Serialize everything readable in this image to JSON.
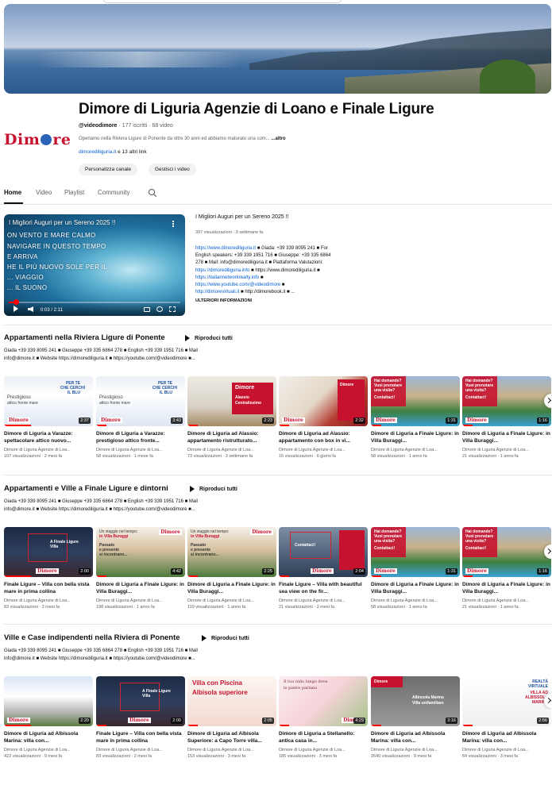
{
  "channel": {
    "title": "Dimore di Liguria Agenzie di Loano e Finale Ligure",
    "logo_text_a": "Dim",
    "logo_text_b": "re",
    "handle": "@videodimore",
    "subscribers": "177 iscritti",
    "videos": "68 video",
    "description": "Operiamo nella Riviera Ligure di Ponente da oltre 30 anni ed abbiamo maturato una com...",
    "more": "...altro",
    "link": "dimorediliguria.it",
    "other_links": "e 13 altri link",
    "customize_button": "Personalizza canale",
    "manage_button": "Gestisci i video"
  },
  "tabs": [
    {
      "label": "Home"
    },
    {
      "label": "Video"
    },
    {
      "label": "Playlist"
    },
    {
      "label": "Community"
    }
  ],
  "featured": {
    "title": "I Migliori Auguri per un Sereno 2025 !!",
    "lyrics": [
      "ON VENTO E MARE CALMO",
      "NAVIGARE IN QUESTO TEMPO",
      "E ARRIVA",
      "HE IL PIÙ NUOVO SOLE PER IL",
      "... VIAGGIO",
      "... IL SUONO"
    ],
    "time": "0:03 / 2:11",
    "progress": 0.04,
    "views": "397 visualizzazioni",
    "age": "3 settimane fa",
    "desc_lines": [
      [
        "https://www.dimorediliguria.it",
        " ■ Giada: +39 339 8095 241 ■ For"
      ],
      [
        "",
        "English speakers: +39 339 1951 716 ■ Giuseppe: +39 335 6864"
      ],
      [
        "",
        "278 ■ Mail: info@dimorediliguria.it ■ Piattaforma Valutazioni:"
      ],
      [
        "https://dimorediliguria.info",
        " ■ https://www.dimorediliguria.it ■"
      ],
      [
        "https://italiannetworkrealty.info",
        " ■"
      ],
      [
        "https://www.youtube.com/@videodimore",
        " ■"
      ],
      [
        "http://dimorevirtuali.it",
        " ■ http://dimorebook.it ■ ..."
      ]
    ],
    "more_info": "ULTERIORI INFORMAZIONI"
  },
  "sections": [
    {
      "title": "Appartamenti nella Riviera Ligure di Ponente",
      "play_all": "Riproduci tutti",
      "desc": [
        "Giada +39 339 8095 241 ■ Giuseppe +39 335 6864 278 ■ English +39 339 1951 716 ■ Mail",
        "info@dimore.it ■ Website https://dimorediliguria.it ■ https://youtube.com/@videodimore ■..."
      ],
      "videos": [
        {
          "title": "Dimore di Liguria a Varazze: spettacolare attico nuovo...",
          "channel": "Dimore di Liguria Agenzie di Loa...",
          "views": "107 visualizzazioni",
          "age": "2 mesi fa",
          "duration": "2:37",
          "theme": "t-blue"
        },
        {
          "title": "Dimore di Liguria a Varazze: prestigioso attico fronte...",
          "channel": "Dimore di Liguria Agenzie di Loa...",
          "views": "58 visualizzazioni",
          "age": "1 mese fa",
          "duration": "3:43",
          "theme": "t-blue"
        },
        {
          "title": "Dimore di Liguria ad Alassio: appartamento ristrutturato...",
          "channel": "Dimore di Liguria Agenzie di Loa...",
          "views": "73 visualizzazioni",
          "age": "3 settimane fa",
          "duration": "2:23",
          "theme": "t-room"
        },
        {
          "title": "Dimore di Liguria ad Alassio: appartamento con box in vi...",
          "channel": "Dimore di Liguria Agenzie di Loa...",
          "views": "16 visualizzazioni",
          "age": "6 giorni fa",
          "duration": "2:32",
          "theme": "t-arch"
        },
        {
          "title": "Dimore di Liguria a Finale Ligure: in Villa Buraggi...",
          "channel": "Dimore di Liguria Agenzie di Loa...",
          "views": "58 visualizzazioni",
          "age": "1 anno fa",
          "duration": "1:31",
          "theme": "t-pool"
        },
        {
          "title": "Dimore di Liguria a Finale Ligure: in Villa Buraggi...",
          "channel": "Dimore di Liguria Agenzie di Loa...",
          "views": "21 visualizzazioni",
          "age": "1 anno fa",
          "duration": "1:16",
          "theme": "t-pool"
        }
      ]
    },
    {
      "title": "Appartamenti e Ville a Finale Ligure e dintorni",
      "play_all": "Riproduci tutti",
      "desc": [
        "Giada +39 339 8095 241 ■ Giuseppe +39 335 6864 278 ■ English +39 339 1951 716 ■ Mail",
        "info@dimore.it ■ Website https://dimorediliguria.it ■ https://youtube.com/@videodimore ■..."
      ],
      "videos": [
        {
          "title": "Finale Ligure – Villa con bella vista mare in prima collina",
          "channel": "Dimore di Liguria Agenzie di Loa...",
          "views": "83 visualizzazioni",
          "age": "2 mesi fa",
          "duration": "2:00",
          "theme": "t-night"
        },
        {
          "title": "Dimore di Liguria a Finale Ligure: in Villa Buraggi...",
          "channel": "Dimore di Liguria Agenzie di Loa...",
          "views": "198 visualizzazioni",
          "age": "1 anno fa",
          "duration": "4:42",
          "theme": "t-villa"
        },
        {
          "title": "Dimore di Liguria a Finale Ligure: in Villa Buraggi...",
          "channel": "Dimore di Liguria Agenzie di Loa...",
          "views": "119 visualizzazioni",
          "age": "1 anno fa",
          "duration": "2:25",
          "theme": "t-villa"
        },
        {
          "title": "Finale Ligure – Villa with beautiful sea view on the fir...",
          "channel": "Dimore di Liguria Agenzie di Loa...",
          "views": "21 visualizzazioni",
          "age": "2 mesi fa",
          "duration": "2:04",
          "theme": "t-sea"
        },
        {
          "title": "Dimore di Liguria a Finale Ligure: in Villa Buraggi...",
          "channel": "Dimore di Liguria Agenzie di Loa...",
          "views": "58 visualizzazioni",
          "age": "1 anno fa",
          "duration": "1:31",
          "theme": "t-pool"
        },
        {
          "title": "Dimore di Liguria a Finale Ligure: in Villa Buraggi...",
          "channel": "Dimore di Liguria Agenzie di Loa...",
          "views": "21 visualizzazioni",
          "age": "1 anno fa",
          "duration": "1:16",
          "theme": "t-pool"
        }
      ]
    },
    {
      "title": "Ville e Case indipendenti nella Riviera di Ponente",
      "play_all": "Riproduci tutti",
      "desc": [
        "Giada +39 339 8095 241 ■ Giuseppe +39 335 6864 278 ■ English +39 339 1951 716 ■ Mail",
        "info@dimore.it ■ Website https://dimorediliguria.it ■ https://youtube.com/@videodimore ■..."
      ],
      "videos": [
        {
          "title": "Dimore di Liguria ad Albissola Marina: villa con...",
          "channel": "Dimore di Liguria Agenzie di Loa...",
          "views": "422 visualizzazioni",
          "age": "9 mesi fa",
          "duration": "2:20",
          "theme": "t-house"
        },
        {
          "title": "Finale Ligure – Villa con bella vista mare in prima collina",
          "channel": "Dimore di Liguria Agenzie di Loa...",
          "views": "83 visualizzazioni",
          "age": "2 mesi fa",
          "duration": "2:00",
          "theme": "t-night"
        },
        {
          "title": "Dimore di Liguria ad Albisola Superiore: a Capo Torre villa...",
          "channel": "Dimore di Liguria Agenzie di Loa...",
          "views": "153 visualizzazioni",
          "age": "3 mesi fa",
          "duration": "2:05",
          "theme": "t-poster"
        },
        {
          "title": "Dimore di Liguria a Stellanello: antica casa in...",
          "channel": "Dimore di Liguria Agenzie di Loa...",
          "views": "185 visualizzazioni",
          "age": "3 mesi fa",
          "duration": "4:29",
          "theme": "t-floral"
        },
        {
          "title": "Dimore di Liguria ad Albissola Marina: villa con...",
          "channel": "Dimore di Liguria Agenzie di Loa...",
          "views": "2640 visualizzazioni",
          "age": "9 mesi fa",
          "duration": "3:16",
          "theme": "t-gray"
        },
        {
          "title": "Dimore di Liguria ad Albissola Marina: villa con...",
          "channel": "Dimore di Liguria Agenzie di Loa...",
          "views": "64 visualizzazioni",
          "age": "3 mesi fa",
          "duration": "2:56",
          "theme": "t-white"
        }
      ]
    }
  ],
  "overlays": {
    "brand": "Dimore",
    "pool_q": "Hai domande?",
    "pool_q2": "Vuoi prenotare",
    "pool_q3": "una visita?",
    "pool_c": "Contattaci!",
    "blue_a": "PER TE",
    "blue_b": "CHE CERCHI",
    "blue_c": "IL BLU",
    "blue_d": "Prestigioso",
    "blue_e": "attico fronte mare",
    "villa_a": "Un viaggio nel tempo:",
    "villa_b": "in Villa Buraggi",
    "villa_c": "Passato",
    "villa_d": "e presente",
    "villa_e": "si incontrano...",
    "room_a": "Alassio",
    "room_b": "Centralissimo",
    "night_a": "A Finale Ligure",
    "night_b": "Villa",
    "poster_a": "Villa con Piscina",
    "poster_b": "Albisola superiore",
    "floral_a": "Il tuo nido lungo dove",
    "floral_b": "le pietre parlano",
    "gray_a": "Albissola Marina",
    "gray_b": "Villa unifamiliare",
    "white_a": "REALTÀ",
    "white_b": "VIRTUALE",
    "white_c": "VILLA AD",
    "white_d": "ALBISSOLA",
    "white_e": "MARINA"
  }
}
